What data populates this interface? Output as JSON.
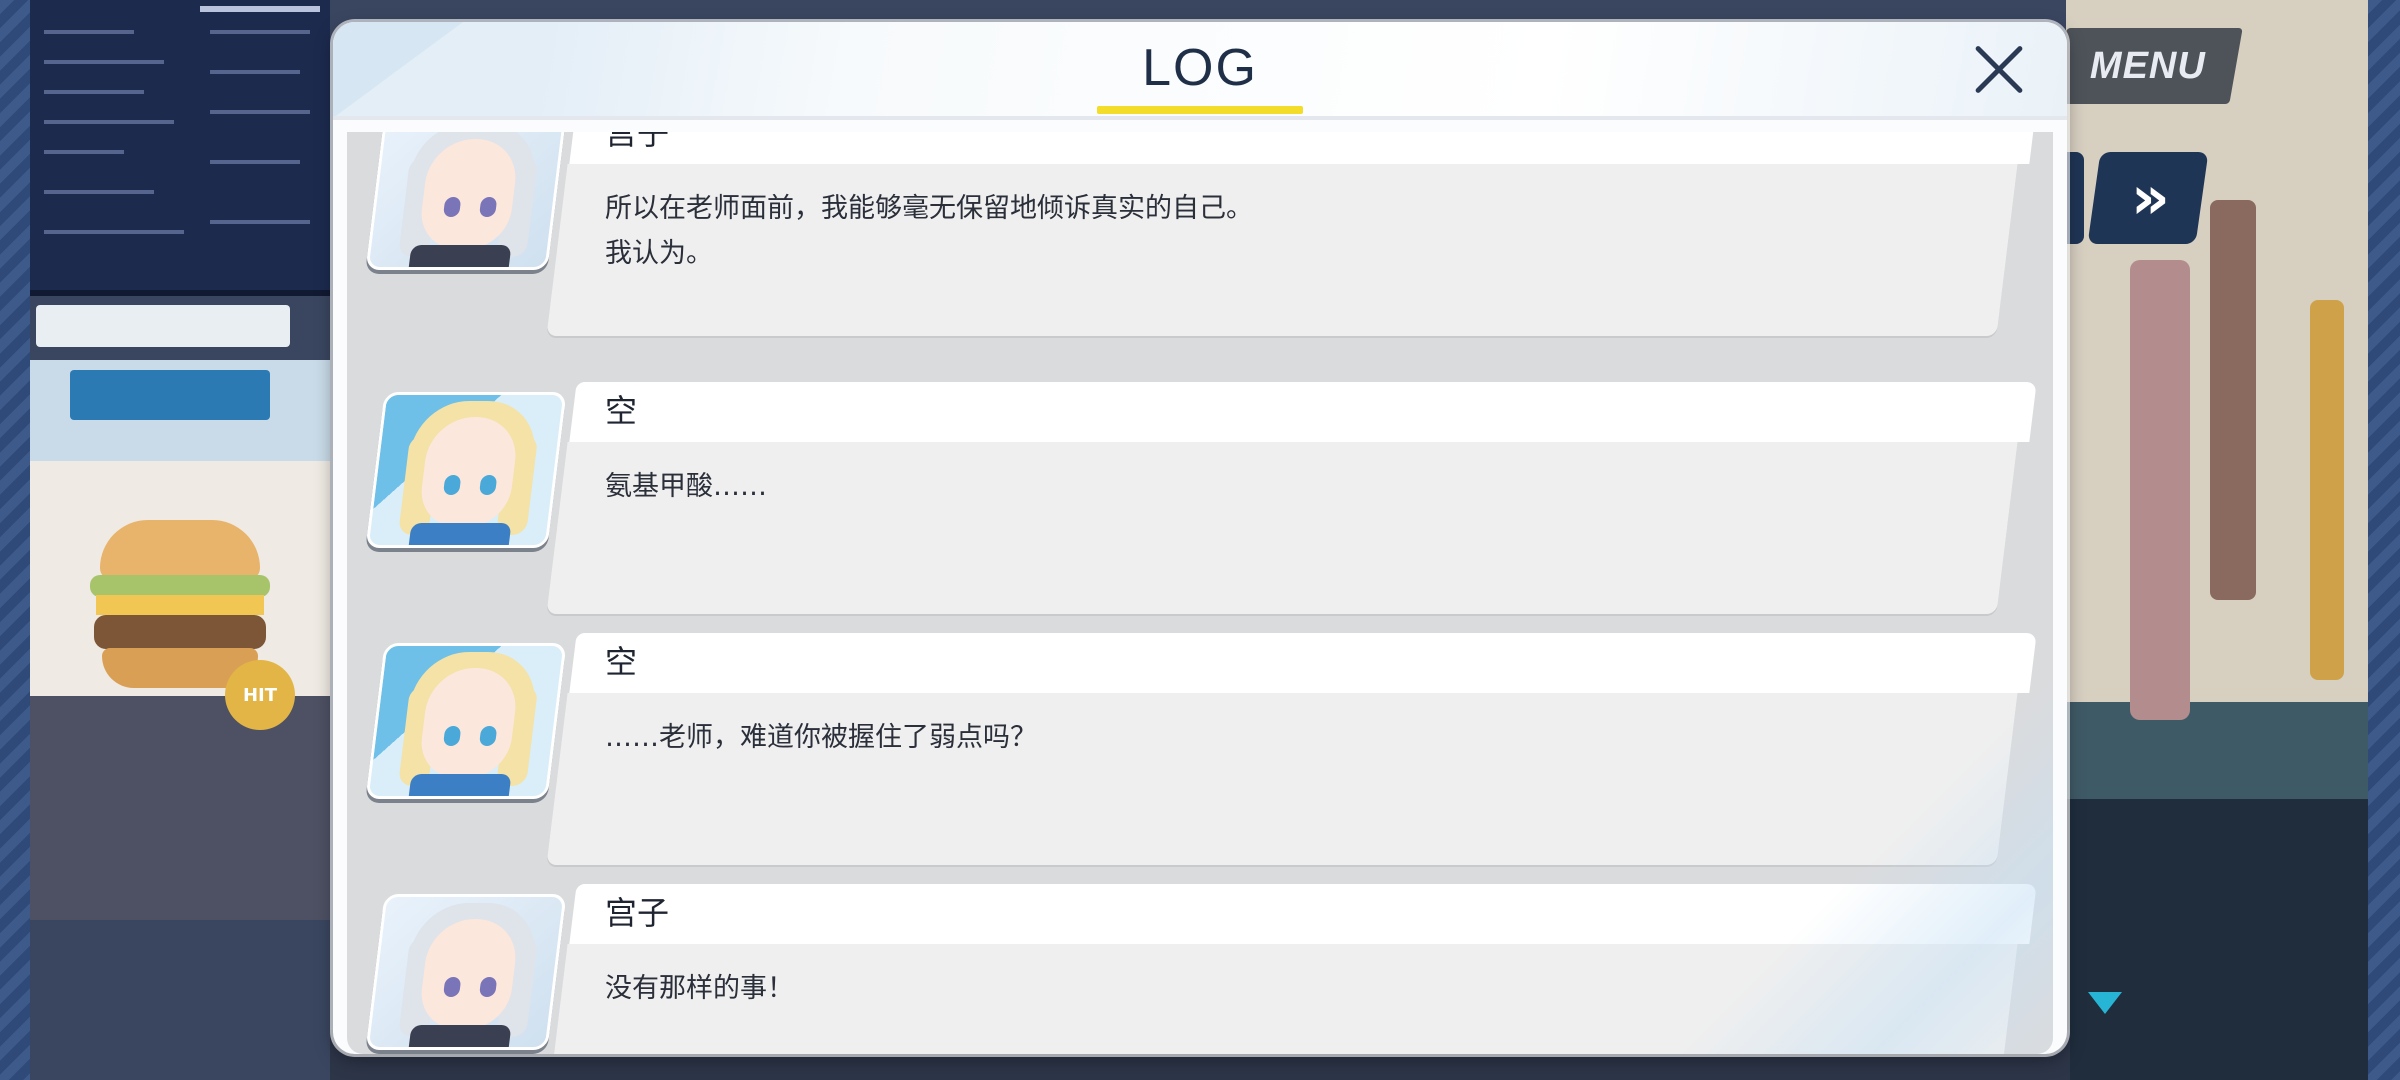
{
  "hud": {
    "menu_label": "MENU",
    "fast_forward_label": "»",
    "poster_badge": "HIT"
  },
  "log": {
    "title": "LOG",
    "close_icon": "close-icon",
    "entries": [
      {
        "speaker": "宫子",
        "portrait": "miyako-portrait",
        "text": "所以在老师面前，我能够毫无保留地倾诉真实的自己。\n我认为。"
      },
      {
        "speaker": "空",
        "portrait": "sora-portrait",
        "text": "氨基甲酸……"
      },
      {
        "speaker": "空",
        "portrait": "sora-portrait",
        "text": "……老师，难道你被握住了弱点吗？"
      },
      {
        "speaker": "宫子",
        "portrait": "miyako-portrait",
        "text": "没有那样的事！"
      }
    ]
  },
  "colors": {
    "title_underline": "#f3dd2a",
    "log_bg": "#dadbdd",
    "name_plate": "#ffffff",
    "message_box": "#efefef",
    "accent_arrow": "#27b5d6"
  }
}
